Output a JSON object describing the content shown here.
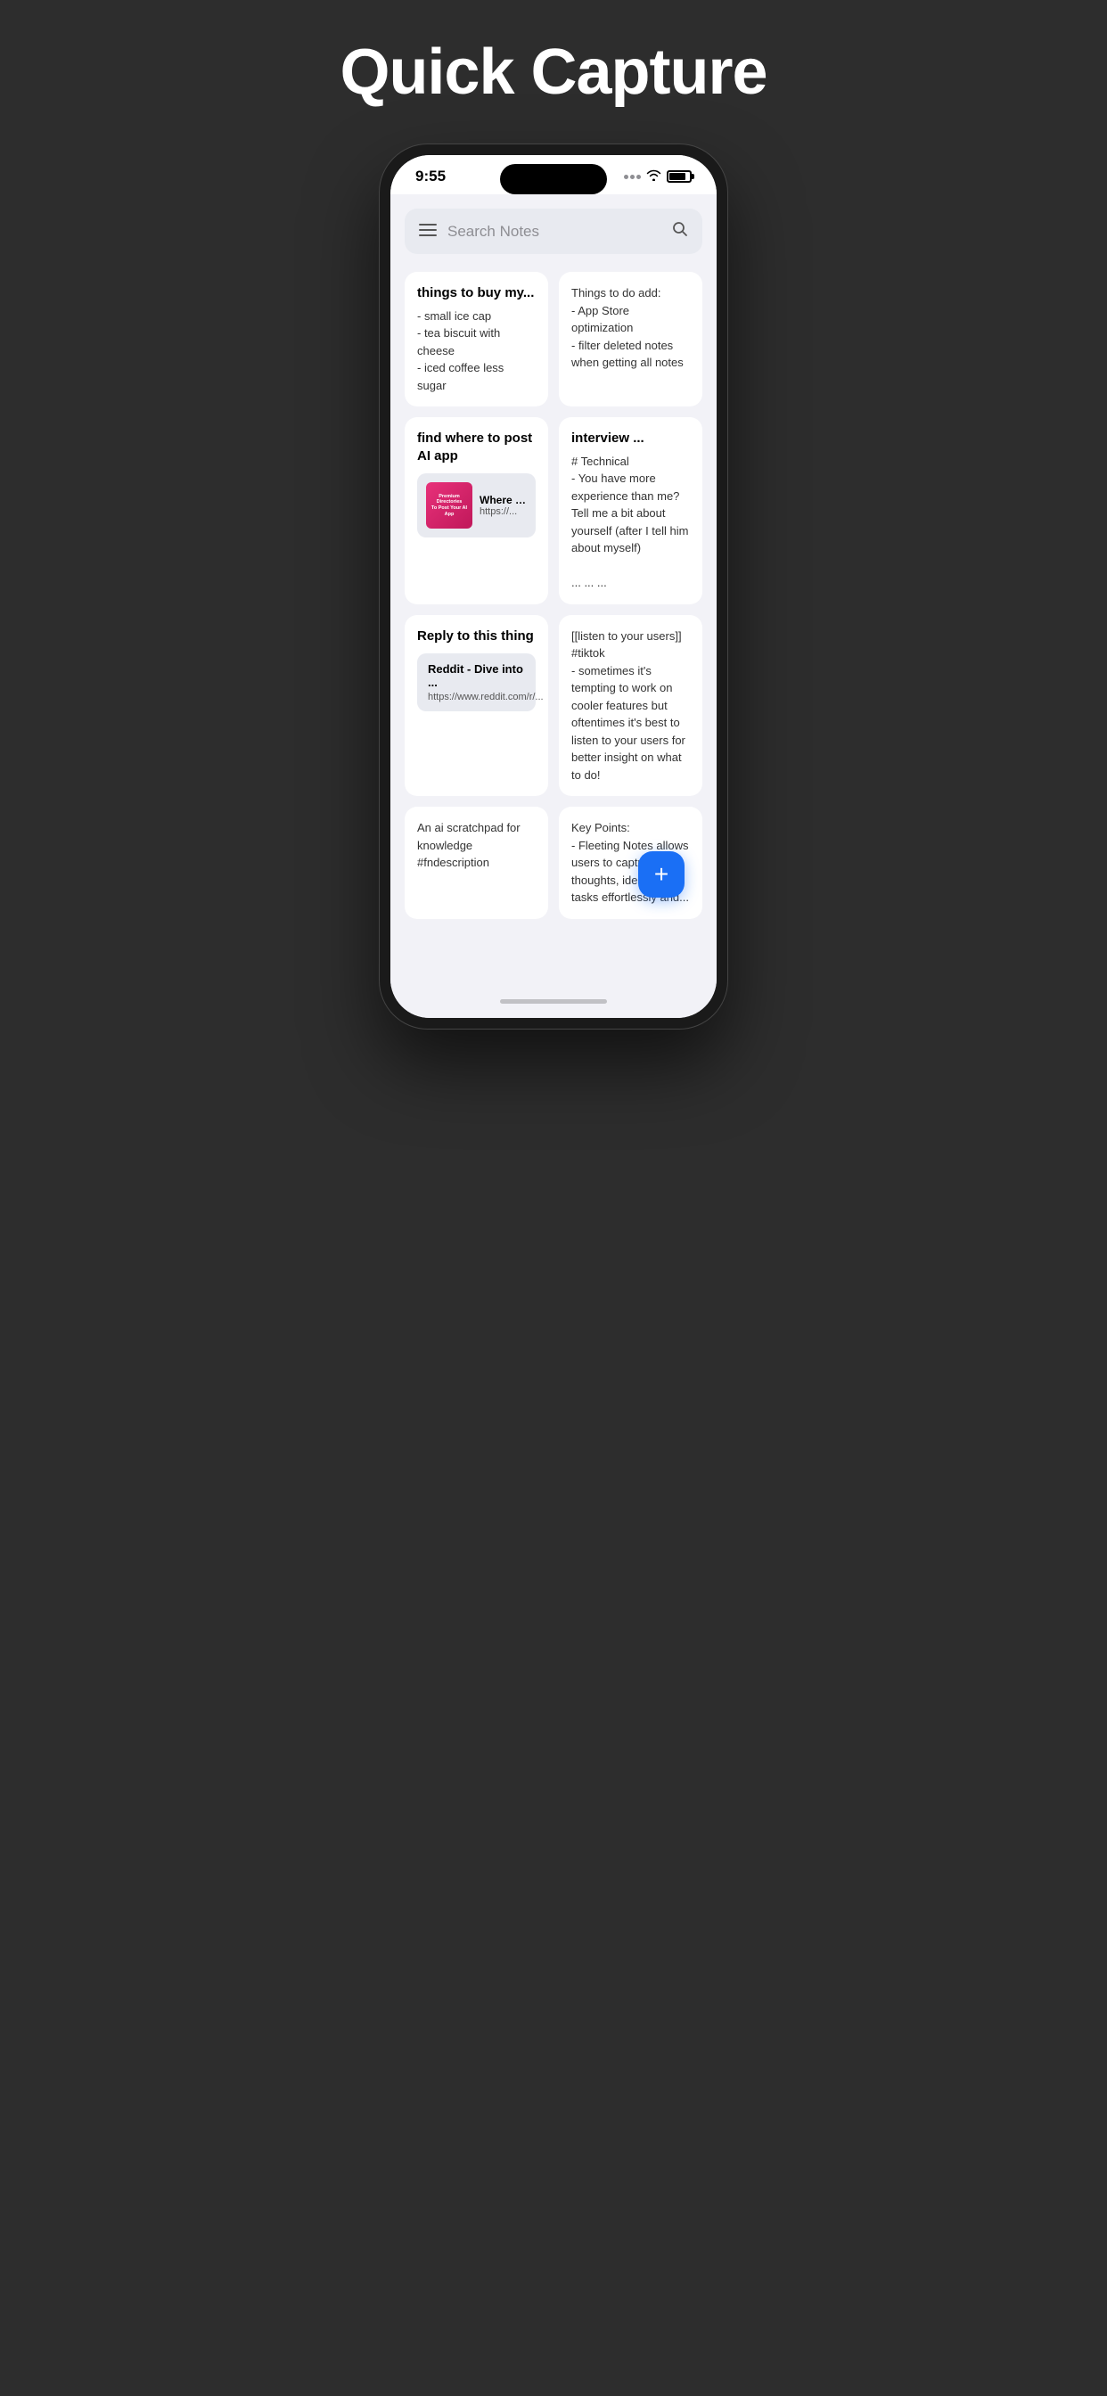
{
  "header": {
    "title": "Quick Capture"
  },
  "phone": {
    "status_bar": {
      "time": "9:55",
      "signal": "...",
      "battery_level": 80
    }
  },
  "search": {
    "placeholder": "Search Notes",
    "menu_icon": "≡",
    "search_icon": "🔍"
  },
  "notes": [
    {
      "id": "note1",
      "title": "things to buy my...",
      "body": "- small ice cap\n- tea biscuit with cheese\n- iced coffee less sugar",
      "has_link": false
    },
    {
      "id": "note2",
      "title": "",
      "body": "Things to do add:\n- App Store optimization\n- filter deleted notes when getting all notes",
      "has_link": false
    },
    {
      "id": "note3",
      "title": "find where to post AI app",
      "body": "",
      "has_link": true,
      "link": {
        "thumb_line1": "Premium Directories",
        "thumb_line2": "To Post Your AI App",
        "title": "Where to ...",
        "url": "https://..."
      }
    },
    {
      "id": "note4",
      "title": "interview ...",
      "body": "# Technical\n- You have more experience than me? Tell me a bit about yourself (after I tell him about myself)\n\n... ... ...",
      "has_link": false
    },
    {
      "id": "note5",
      "title": "Reply to this thing",
      "body": "",
      "has_link": true,
      "link": {
        "type": "reddit",
        "title": "Reddit - Dive into ...",
        "url": "https://www.reddit.com/r/..."
      }
    },
    {
      "id": "note6",
      "title": "",
      "body": "[[listen to your users]] #tiktok\n- sometimes it's tempting to work on cooler features but oftentimes it's best to listen to your users for better insight on what to do!",
      "has_link": false
    },
    {
      "id": "note7",
      "title": "",
      "body": "An ai scratchpad for knowledge #fndescription",
      "has_link": false
    },
    {
      "id": "note8",
      "title": "",
      "body": "Key Points:\n- Fleeting Notes allows users to capture thoughts, ideas, and tasks effortlessly and...",
      "has_link": false
    }
  ],
  "fab": {
    "label": "+"
  }
}
